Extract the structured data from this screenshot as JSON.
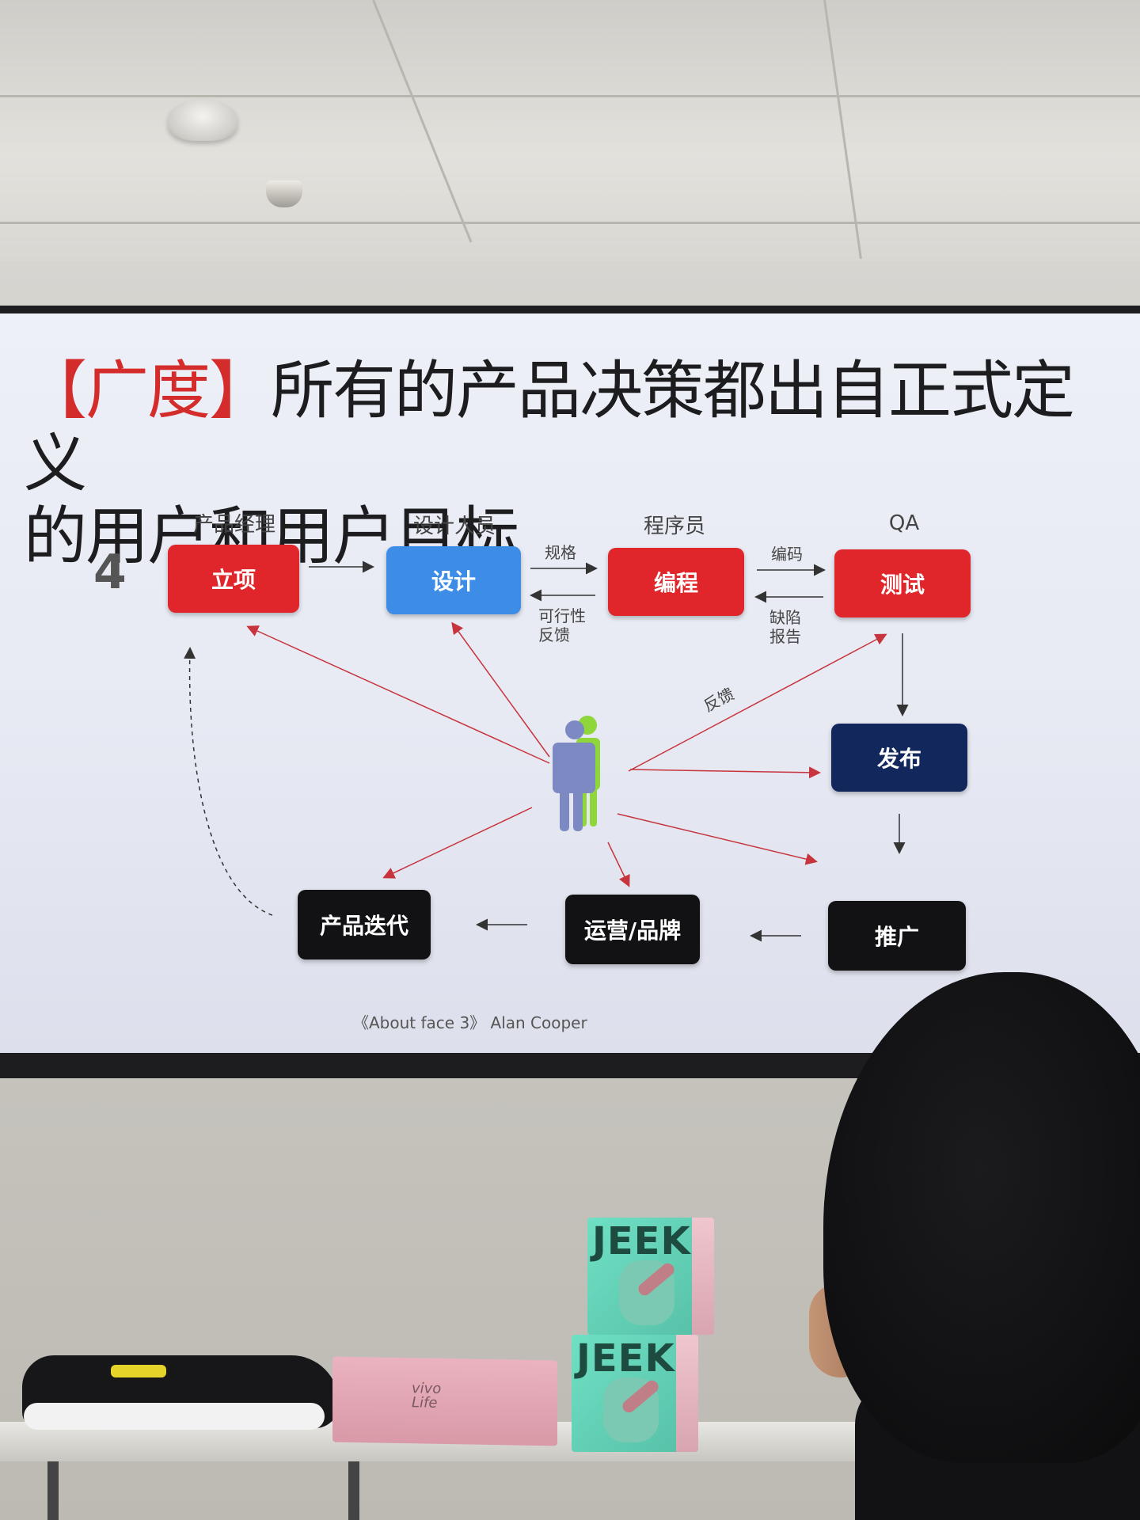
{
  "slide": {
    "title_bracket": "【广度】",
    "title_line1": "所有的产品决策都出自正式定义",
    "title_line2": "的用户和用户目标",
    "step_number": "4",
    "citation": "《About face 3》 Alan Cooper"
  },
  "roles": {
    "pm": "产品经理",
    "designer": "设计人员",
    "programmer": "程序员",
    "qa": "QA"
  },
  "boxes": {
    "initiate": "立项",
    "design": "设计",
    "code": "编程",
    "test": "测试",
    "release": "发布",
    "promote": "推广",
    "ops": "运营/品牌",
    "iterate": "产品迭代"
  },
  "arrow_labels": {
    "spec": "规格",
    "feasibility": "可行性\n反馈",
    "coding": "编码",
    "defect": "缺陷\n报告",
    "feedback": "反馈"
  },
  "colors": {
    "red": "#e0262a",
    "blue": "#3d8de6",
    "navy": "#12275c",
    "black": "#121214",
    "arrow_red": "#c8343d",
    "user_blue": "#7d89c2",
    "user_green": "#8fd63a"
  },
  "props": {
    "mug_box_text": "JEEK",
    "pink_box_text": "vivo Life"
  }
}
